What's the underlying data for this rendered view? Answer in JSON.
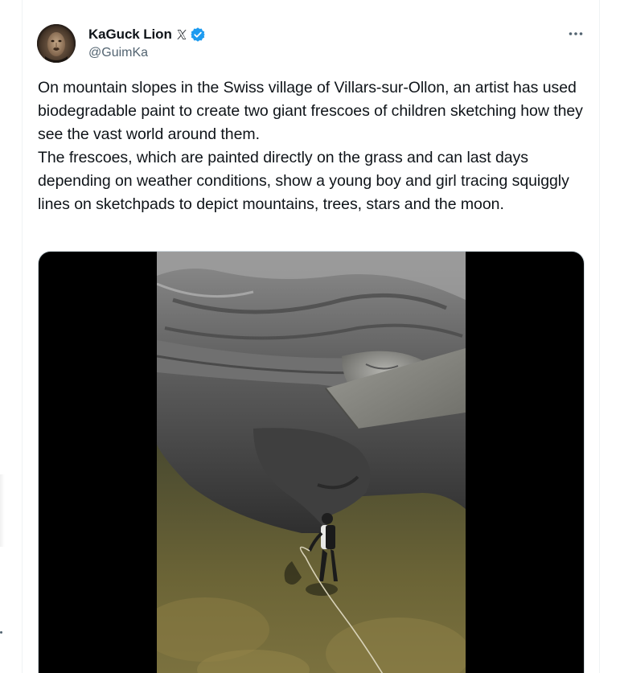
{
  "author": {
    "display_name": "KaGuck Lion",
    "handle": "@GuimKa",
    "verified": true,
    "avatar_icon": "lion-avatar",
    "badge_icons": [
      "x-logo-icon",
      "verified-badge-icon"
    ]
  },
  "tweet": {
    "paragraphs": [
      "On mountain slopes in the Swiss village of Villars-sur-Ollon, an artist has used biodegradable paint to create two giant frescoes of children sketching how they see the vast world around them.",
      "The frescoes, which are painted directly on the grass and can last days depending on weather conditions, show a young boy and girl tracing squiggly lines on sketchpads to depict mountains, trees, stars and the moon."
    ]
  },
  "media": {
    "type": "video",
    "content": "aerial view of a grass fresco of a child's arm and sketchpad with an artist holding a hose"
  },
  "colors": {
    "text_primary": "#0f1419",
    "text_secondary": "#536471",
    "verified_blue": "#1d9bf0",
    "border": "#eff3f4",
    "media_background": "#000000"
  }
}
